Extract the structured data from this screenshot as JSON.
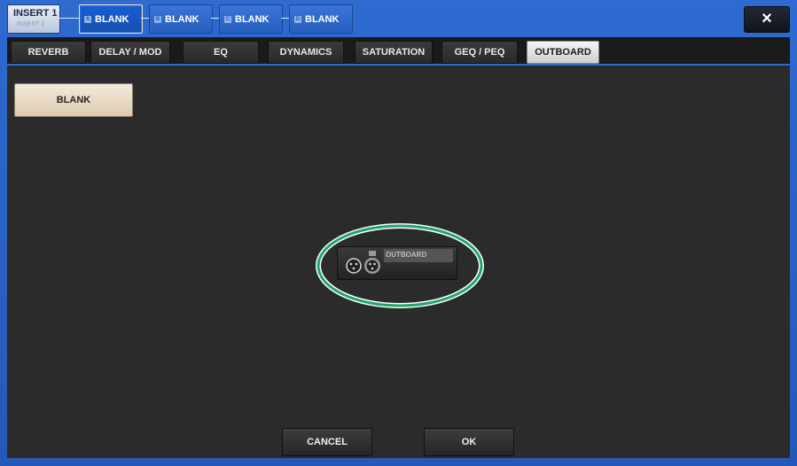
{
  "header": {
    "insert_primary": "INSERT 1",
    "insert_secondary": "INSERT 2",
    "slots": [
      {
        "num": "A",
        "label": "BLANK"
      },
      {
        "num": "B",
        "label": "BLANK"
      },
      {
        "num": "C",
        "label": "BLANK"
      },
      {
        "num": "D",
        "label": "BLANK"
      }
    ],
    "close_label": "×"
  },
  "tabs": [
    {
      "label": "REVERB"
    },
    {
      "label": "DELAY / MOD"
    },
    {
      "label": "EQ"
    },
    {
      "label": "DYNAMICS"
    },
    {
      "label": "SATURATION"
    },
    {
      "label": "GEQ / PEQ"
    },
    {
      "label": "OUTBOARD",
      "active": true
    }
  ],
  "main": {
    "blank_label": "BLANK",
    "outboard_label": "OUTBOARD",
    "outboard_icon": "xlr-connectors-icon",
    "highlight_color": "#1fa66b"
  },
  "footer": {
    "cancel_label": "CANCEL",
    "ok_label": "OK"
  }
}
